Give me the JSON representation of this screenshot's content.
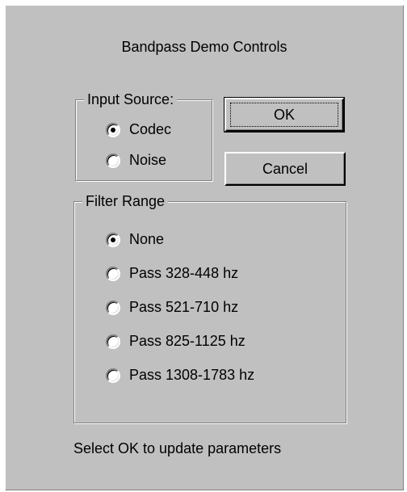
{
  "dialog": {
    "title": "Bandpass Demo Controls",
    "status_text": "Select OK to update parameters"
  },
  "input_source": {
    "label": "Input Source:",
    "options": [
      {
        "label": "Codec",
        "checked": true
      },
      {
        "label": "Noise",
        "checked": false
      }
    ]
  },
  "filter_range": {
    "label": "Filter Range",
    "options": [
      {
        "label": "None",
        "checked": true
      },
      {
        "label": "Pass 328-448 hz",
        "checked": false
      },
      {
        "label": "Pass 521-710 hz",
        "checked": false
      },
      {
        "label": "Pass 825-1125 hz",
        "checked": false
      },
      {
        "label": "Pass 1308-1783 hz",
        "checked": false
      }
    ]
  },
  "buttons": {
    "ok_label": "OK",
    "cancel_label": "Cancel"
  },
  "colors": {
    "dialog_face": "#c0c0c0",
    "highlight": "#ffffff",
    "shadow": "#808080",
    "text": "#000000"
  }
}
